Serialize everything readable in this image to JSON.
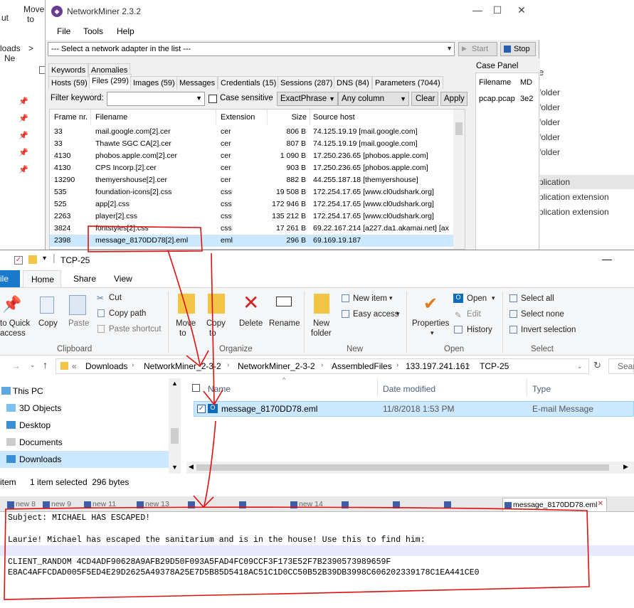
{
  "background_explorer": {
    "ribbon_left": [
      "ut",
      "Move",
      "to"
    ],
    "path_fragment": "loads",
    "path_arrow": ">",
    "path_next": "Ne",
    "right_items": [
      "folder",
      "folder",
      "folder",
      "folder",
      "folder"
    ],
    "right_items_lower": [
      "plication",
      "plication extension",
      "plication extension"
    ]
  },
  "networkminer": {
    "title": "NetworkMiner 2.3.2",
    "menu": [
      "File",
      "Tools",
      "Help"
    ],
    "adapter_placeholder": "--- Select a network adapter in the list ---",
    "start_label": "Start",
    "stop_label": "Stop",
    "tabs_row1": [
      "Keywords",
      "Anomalies"
    ],
    "tabs_row2": [
      "Hosts (59)",
      "Files (299)",
      "Images (59)",
      "Messages",
      "Credentials (15)",
      "Sessions (287)",
      "DNS (84)",
      "Parameters (7044)"
    ],
    "filter_label": "Filter keyword:",
    "case_sensitive_label": "Case sensitive",
    "match_mode": "ExactPhrase",
    "column_mode": "Any column",
    "clear_label": "Clear",
    "apply_label": "Apply",
    "columns": [
      "Frame nr.",
      "Filename",
      "Extension",
      "Size",
      "Source host"
    ],
    "rows": [
      {
        "frame": "33",
        "filename": "mail.google.com[2].cer",
        "ext": "cer",
        "size": "806 B",
        "source": "74.125.19.19 [mail.google.com]"
      },
      {
        "frame": "33",
        "filename": "Thawte SGC CA[2].cer",
        "ext": "cer",
        "size": "807 B",
        "source": "74.125.19.19 [mail.google.com]"
      },
      {
        "frame": "4130",
        "filename": "phobos.apple.com[2].cer",
        "ext": "cer",
        "size": "1 090 B",
        "source": "17.250.236.65 [phobos.apple.com]"
      },
      {
        "frame": "4130",
        "filename": "CPS Incorp.[2].cer",
        "ext": "cer",
        "size": "903 B",
        "source": "17.250.236.65 [phobos.apple.com]"
      },
      {
        "frame": "13290",
        "filename": "themyershouse[2].cer",
        "ext": "cer",
        "size": "882 B",
        "source": "44.255.187.18 [themyershouse]"
      },
      {
        "frame": "535",
        "filename": "foundation-icons[2].css",
        "ext": "css",
        "size": "19 508 B",
        "source": "172.254.17.65 [www.cl0udshark.org]"
      },
      {
        "frame": "525",
        "filename": "app[2].css",
        "ext": "css",
        "size": "172 946 B",
        "source": "172.254.17.65 [www.cl0udshark.org]"
      },
      {
        "frame": "2263",
        "filename": "player[2].css",
        "ext": "css",
        "size": "135 212 B",
        "source": "172.254.17.65 [www.cl0udshark.org]"
      },
      {
        "frame": "3824",
        "filename": "fontstyles[2].css",
        "ext": "css",
        "size": "17 261 B",
        "source": "69.22.167.214 [a227.da1.akamai.net] [ax"
      },
      {
        "frame": "2398",
        "filename": "message_8170DD78[2].eml",
        "ext": "eml",
        "size": "296 B",
        "source": "69.169.19.187"
      }
    ],
    "case_panel": {
      "title": "Case Panel",
      "columns": [
        "Filename",
        "MD"
      ],
      "file": "pcap.pcap",
      "hash_fragment": "3e2"
    }
  },
  "file_explorer": {
    "title": "TCP-25",
    "tabs": {
      "file": "ile",
      "home": "Home",
      "share": "Share",
      "view": "View"
    },
    "ribbon": {
      "pin_label_1": "to Quick",
      "pin_label_2": "access",
      "copy": "Copy",
      "paste": "Paste",
      "cut": "Cut",
      "copy_path": "Copy path",
      "paste_shortcut": "Paste shortcut",
      "move_to_1": "Move",
      "move_to_2": "to",
      "copy_to_1": "Copy",
      "copy_to_2": "to",
      "delete": "Delete",
      "rename": "Rename",
      "new_folder_1": "New",
      "new_folder_2": "folder",
      "new_item": "New item",
      "easy_access": "Easy access",
      "properties": "Properties",
      "open": "Open",
      "edit": "Edit",
      "history": "History",
      "select_all": "Select all",
      "select_none": "Select none",
      "invert_selection": "Invert selection",
      "groups": [
        "Clipboard",
        "Organize",
        "New",
        "Open",
        "Select"
      ]
    },
    "breadcrumb": [
      "Downloads",
      "NetworkMiner_2-3-2",
      "NetworkMiner_2-3-2",
      "AssembledFiles",
      "133.197.241.161",
      "TCP-25"
    ],
    "breadcrumb_prefix": "«",
    "search_placeholder": "Sear",
    "nav": [
      "This PC",
      "3D Objects",
      "Desktop",
      "Documents",
      "Downloads"
    ],
    "list_columns": [
      "Name",
      "Date modified",
      "Type"
    ],
    "file": {
      "name": "message_8170DD78.eml",
      "date": "11/8/2018 1:53 PM",
      "type": "E-mail Message"
    },
    "status": {
      "items": "item",
      "selected": "1 item selected  296 bytes"
    }
  },
  "editor": {
    "tabs": [
      "new 8",
      "new 9",
      "new 11",
      "new 13",
      "new 14",
      "message_8170DD78.eml"
    ],
    "lines": [
      "Subject: MICHAEL HAS ESCAPED!",
      "",
      "Laurie! Michael has escaped the sanitarium and is in the house! Use this to find him:",
      "",
      "CLIENT_RANDOM 4CD4ADF90628A9AFB29D50F093A5FAD4FC09CCF3F173E52F7B2390573989659F",
      "E8AC4AFFCDAD005F5ED4E29D2625A49378A25E7D5B85D5418AC51C1D0CC50B52B39DB3998C606202339178C1EA441CE0"
    ]
  },
  "colors": {
    "annotation": "#e01010",
    "selection": "#cce8ff",
    "accent": "#1979ca"
  }
}
